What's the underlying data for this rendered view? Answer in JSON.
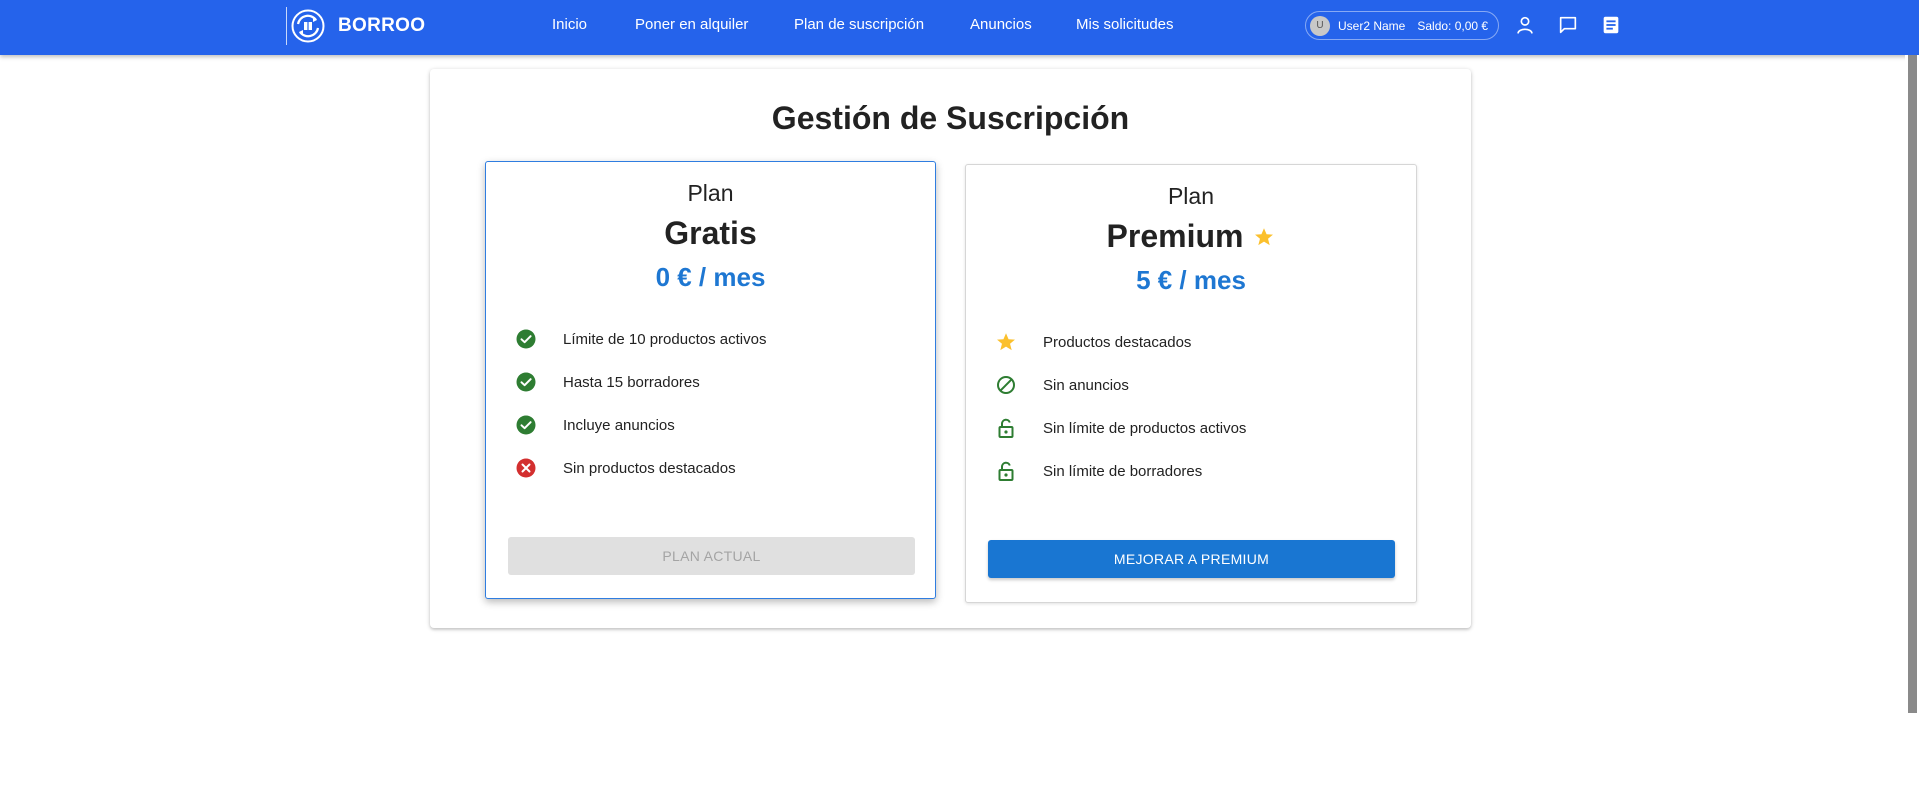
{
  "brand": {
    "name": "BORROO",
    "logo_icon": "borroo-logo-icon"
  },
  "nav": {
    "items": [
      {
        "label": "Inicio"
      },
      {
        "label": "Poner en alquiler"
      },
      {
        "label": "Plan de suscripción"
      },
      {
        "label": "Anuncios"
      },
      {
        "label": "Mis solicitudes"
      }
    ]
  },
  "user": {
    "avatar_letter": "U",
    "name": "User2 Name",
    "balance": "Saldo: 0,00 €"
  },
  "header_icons": [
    "profile-icon",
    "chat-icon",
    "notes-icon"
  ],
  "page": {
    "title": "Gestión de Suscripción"
  },
  "plans": {
    "free": {
      "kicker": "Plan",
      "name": "Gratis",
      "price": "0 € / mes",
      "features": [
        {
          "text": "Límite de 10 productos activos",
          "icon": "check-circle-icon"
        },
        {
          "text": "Hasta 15 borradores",
          "icon": "check-circle-icon"
        },
        {
          "text": "Incluye anuncios",
          "icon": "check-circle-icon"
        },
        {
          "text": "Sin productos destacados",
          "icon": "cancel-circle-icon"
        }
      ],
      "button_label": "PLAN ACTUAL"
    },
    "premium": {
      "kicker": "Plan",
      "name": "Premium",
      "price": "5 € / mes",
      "features": [
        {
          "text": "Productos destacados",
          "icon": "star-icon"
        },
        {
          "text": "Sin anuncios",
          "icon": "block-icon"
        },
        {
          "text": "Sin límite de productos activos",
          "icon": "unlock-icon"
        },
        {
          "text": "Sin límite de borradores",
          "icon": "unlock-icon"
        }
      ],
      "button_label": "MEJORAR A PREMIUM"
    }
  },
  "colors": {
    "topbar": "#2563eb",
    "accent": "#1976d2",
    "price": "#1e77d2",
    "check": "#2e7d32",
    "error": "#d32f2f",
    "star": "#fbc02d"
  }
}
